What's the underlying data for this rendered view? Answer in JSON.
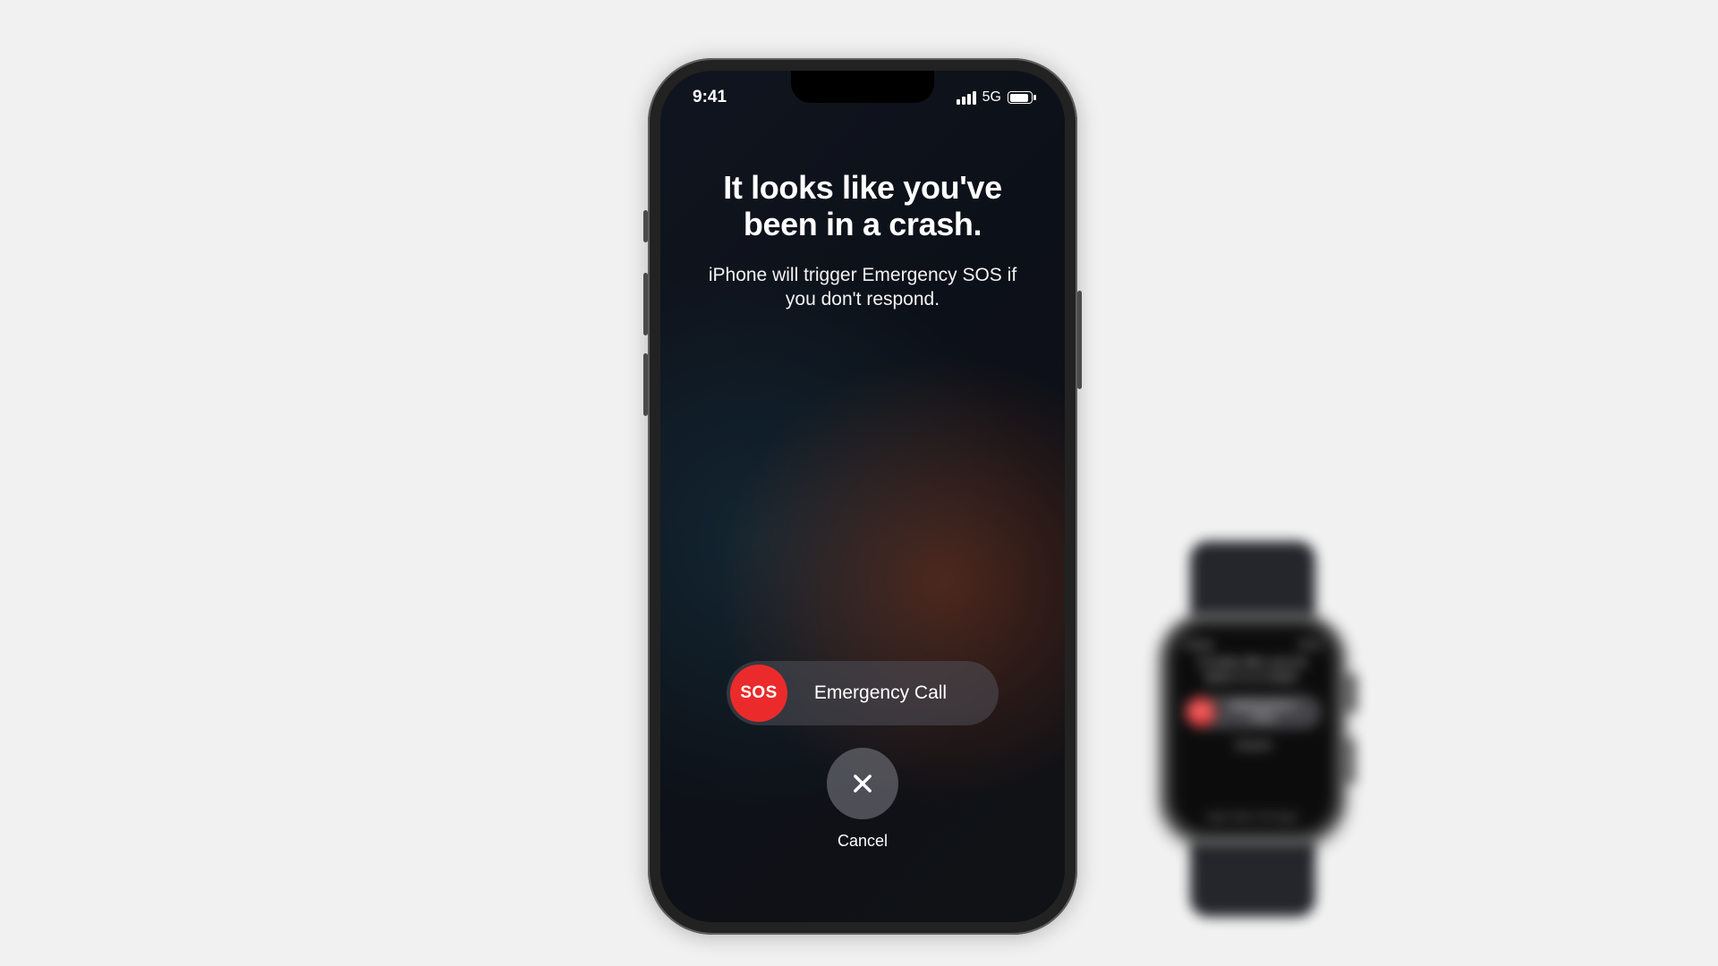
{
  "phone": {
    "status": {
      "time": "9:41",
      "network": "5G"
    },
    "headline": "It looks like you've been in a crash.",
    "subline": "iPhone will trigger Emergency SOS if you don't respond.",
    "sos_knob": "SOS",
    "sos_label": "Emergency Call",
    "cancel_label": "Cancel"
  },
  "watch": {
    "close": "Close",
    "time": "9:41",
    "title": "It looks like you've been in a crash.",
    "sos_knob": "SOS",
    "sos_label": "EMERGENCY CALL",
    "cancel": "Cancel",
    "footer": "Apple Watch will trigger"
  },
  "colors": {
    "sos_red": "#eb2b2b",
    "bg_gray": "#f1f1f1"
  }
}
